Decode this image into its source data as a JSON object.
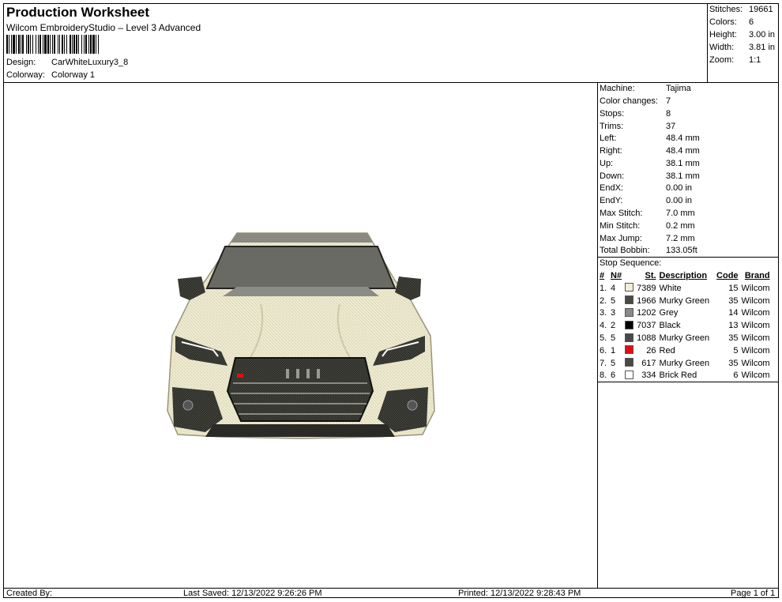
{
  "header": {
    "title": "Production Worksheet",
    "software": "Wilcom EmbroideryStudio – Level 3 Advanced",
    "design_label": "Design:",
    "design_value": "CarWhiteLuxury3_8",
    "colorway_label": "Colorway:",
    "colorway_value": "Colorway 1"
  },
  "summary": {
    "stitches_label": "Stitches:",
    "stitches_value": "19661",
    "colors_label": "Colors:",
    "colors_value": "6",
    "height_label": "Height:",
    "height_value": "3.00 in",
    "width_label": "Width:",
    "width_value": "3.81 in",
    "zoom_label": "Zoom:",
    "zoom_value": "1:1"
  },
  "details": [
    {
      "label": "Machine:",
      "value": "Tajima"
    },
    {
      "label": "Color changes:",
      "value": "7"
    },
    {
      "label": "Stops:",
      "value": "8"
    },
    {
      "label": "Trims:",
      "value": "37"
    },
    {
      "label": "Left:",
      "value": "48.4 mm"
    },
    {
      "label": "Right:",
      "value": "48.4 mm"
    },
    {
      "label": "Up:",
      "value": "38.1 mm"
    },
    {
      "label": "Down:",
      "value": "38.1 mm"
    },
    {
      "label": "EndX:",
      "value": "0.00 in"
    },
    {
      "label": "EndY:",
      "value": "0.00 in"
    },
    {
      "label": "Max Stitch:",
      "value": "7.0 mm"
    },
    {
      "label": "Min Stitch:",
      "value": "0.2 mm"
    },
    {
      "label": "Max Jump:",
      "value": "7.2 mm"
    },
    {
      "label": "Total Bobbin:",
      "value": "133.05ft"
    }
  ],
  "stop_sequence": {
    "heading": "Stop Sequence:",
    "columns": {
      "num": "#",
      "n": "N#",
      "st": "St.",
      "description": "Description",
      "code": "Code",
      "brand": "Brand"
    },
    "rows": [
      {
        "num": "1.",
        "n": "4",
        "color": "#f3ecd6",
        "st": "7389",
        "description": "White",
        "code": "15",
        "brand": "Wilcom"
      },
      {
        "num": "2.",
        "n": "5",
        "color": "#4a4a44",
        "st": "1966",
        "description": "Murky Green",
        "code": "35",
        "brand": "Wilcom"
      },
      {
        "num": "3.",
        "n": "3",
        "color": "#8a8a88",
        "st": "1202",
        "description": "Grey",
        "code": "14",
        "brand": "Wilcom"
      },
      {
        "num": "4.",
        "n": "2",
        "color": "#000000",
        "st": "7037",
        "description": "Black",
        "code": "13",
        "brand": "Wilcom"
      },
      {
        "num": "5.",
        "n": "5",
        "color": "#4a4a44",
        "st": "1088",
        "description": "Murky Green",
        "code": "35",
        "brand": "Wilcom"
      },
      {
        "num": "6.",
        "n": "1",
        "color": "#dd1111",
        "st": "26",
        "description": "Red",
        "code": "5",
        "brand": "Wilcom"
      },
      {
        "num": "7.",
        "n": "5",
        "color": "#4a4a44",
        "st": "617",
        "description": "Murky Green",
        "code": "35",
        "brand": "Wilcom"
      },
      {
        "num": "8.",
        "n": "6",
        "color": "#ffffff",
        "st": "334",
        "description": "Brick Red",
        "code": "6",
        "brand": "Wilcom"
      }
    ]
  },
  "footer": {
    "created_by": "Created By:",
    "last_saved": "Last Saved: 12/13/2022 9:26:26 PM",
    "printed": "Printed: 12/13/2022 9:28:43 PM",
    "page": "Page 1 of 1"
  }
}
